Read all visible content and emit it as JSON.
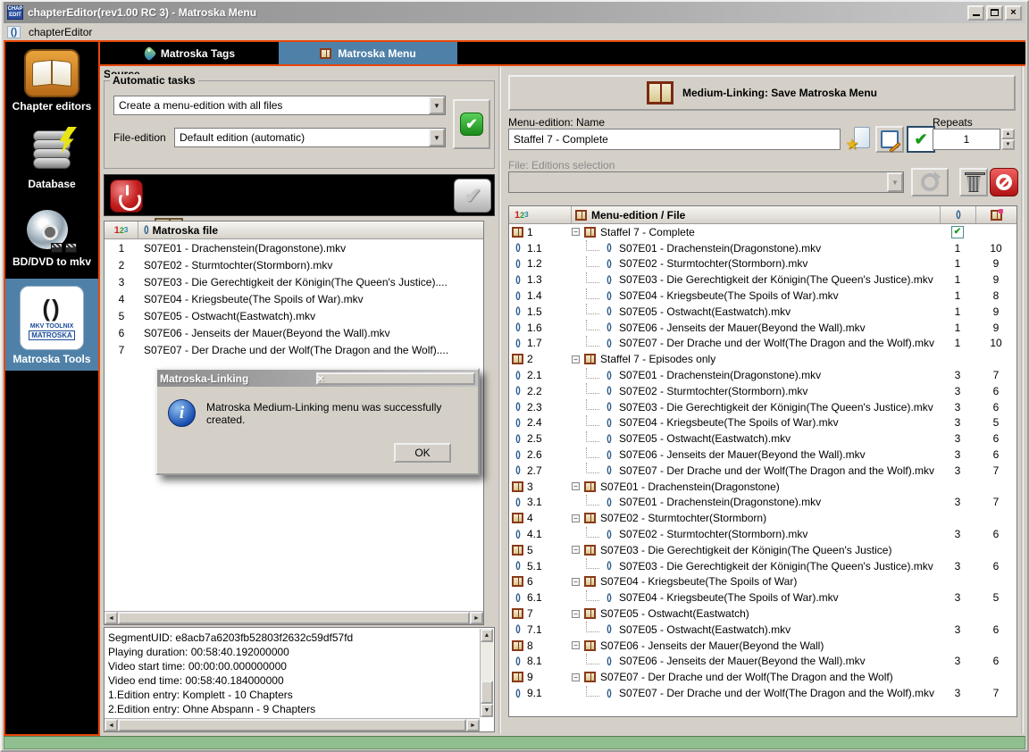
{
  "window": {
    "title": "chapterEditor(rev1.00 RC 3) - Matroska Menu",
    "app_icon_line1": "CHAP",
    "app_icon_line2": "EDIT"
  },
  "menu_bar": {
    "item": "chapterEditor"
  },
  "sidebar": {
    "items": [
      {
        "label": "Chapter editors"
      },
      {
        "label": "Database"
      },
      {
        "label": "BD/DVD to mkv"
      },
      {
        "label": "Matroska Tools",
        "icon_text_1": "MKV TOOLNIX",
        "icon_text_2": "MATROSKA"
      }
    ]
  },
  "tabs": [
    {
      "label": "Matroska Tags"
    },
    {
      "label": "Matroska Menu"
    }
  ],
  "num_header": {
    "d1": "1",
    "d2": "2",
    "d3": "3"
  },
  "source": {
    "title": "Source",
    "group_title": "Automatic tasks",
    "task_value": "Create a menu-edition with all files",
    "file_edition_label": "File-edition",
    "file_edition_value": "Default edition (automatic)"
  },
  "file_table": {
    "file_col": "Matroska file",
    "rows": [
      {
        "n": "1",
        "file": "S07E01 - Drachenstein(Dragonstone).mkv"
      },
      {
        "n": "2",
        "file": "S07E02 - Sturmtochter(Stormborn).mkv"
      },
      {
        "n": "3",
        "file": "S07E03 - Die Gerechtigkeit der Königin(The Queen's Justice)...."
      },
      {
        "n": "4",
        "file": "S07E04 - Kriegsbeute(The Spoils of War).mkv"
      },
      {
        "n": "5",
        "file": "S07E05 - Ostwacht(Eastwatch).mkv"
      },
      {
        "n": "6",
        "file": "S07E06 - Jenseits der Mauer(Beyond the Wall).mkv"
      },
      {
        "n": "7",
        "file": "S07E07 - Der Drache und der Wolf(The Dragon and the Wolf)...."
      }
    ]
  },
  "dialog": {
    "title": "Matroska-Linking",
    "message": "Matroska Medium-Linking menu was successfully created.",
    "ok": "OK"
  },
  "info_box": {
    "lines": [
      "SegmentUID: e8acb7a6203fb52803f2632c59df57fd",
      "Playing duration: 00:58:40.192000000",
      "Video start time: 00:00:00.000000000",
      "Video end time: 00:58:40.184000000",
      "1.Edition entry: Komplett - 10 Chapters",
      "2.Edition entry: Ohne Abspann - 9 Chapters"
    ]
  },
  "right_panel": {
    "banner": "Medium-Linking: Save Matroska Menu",
    "name_label": "Menu-edition: Name",
    "name_value": "Staffel 7 - Complete",
    "repeats_label": "Repeats",
    "repeats_value": "1",
    "editions_label": "File: Editions selection",
    "editions_value": ""
  },
  "tree": {
    "file_col": "Menu-edition / File",
    "rows": [
      {
        "id": "1",
        "type": "menu",
        "label": "Staffel 7 - Complete",
        "c1": "✔",
        "c2": ""
      },
      {
        "id": "1.1",
        "type": "file",
        "label": "S07E01 - Drachenstein(Dragonstone).mkv",
        "c1": "1",
        "c2": "10"
      },
      {
        "id": "1.2",
        "type": "file",
        "label": "S07E02 - Sturmtochter(Stormborn).mkv",
        "c1": "1",
        "c2": "9"
      },
      {
        "id": "1.3",
        "type": "file",
        "label": "S07E03 - Die Gerechtigkeit der Königin(The Queen's Justice).mkv",
        "c1": "1",
        "c2": "9"
      },
      {
        "id": "1.4",
        "type": "file",
        "label": "S07E04 - Kriegsbeute(The Spoils of War).mkv",
        "c1": "1",
        "c2": "8"
      },
      {
        "id": "1.5",
        "type": "file",
        "label": "S07E05 - Ostwacht(Eastwatch).mkv",
        "c1": "1",
        "c2": "9"
      },
      {
        "id": "1.6",
        "type": "file",
        "label": "S07E06 - Jenseits der Mauer(Beyond the Wall).mkv",
        "c1": "1",
        "c2": "9"
      },
      {
        "id": "1.7",
        "type": "file",
        "label": "S07E07 - Der Drache und der Wolf(The Dragon and the Wolf).mkv",
        "c1": "1",
        "c2": "10"
      },
      {
        "id": "2",
        "type": "menu",
        "label": "Staffel 7 - Episodes only",
        "c1": "",
        "c2": ""
      },
      {
        "id": "2.1",
        "type": "file",
        "label": "S07E01 - Drachenstein(Dragonstone).mkv",
        "c1": "3",
        "c2": "7"
      },
      {
        "id": "2.2",
        "type": "file",
        "label": "S07E02 - Sturmtochter(Stormborn).mkv",
        "c1": "3",
        "c2": "6"
      },
      {
        "id": "2.3",
        "type": "file",
        "label": "S07E03 - Die Gerechtigkeit der Königin(The Queen's Justice).mkv",
        "c1": "3",
        "c2": "6"
      },
      {
        "id": "2.4",
        "type": "file",
        "label": "S07E04 - Kriegsbeute(The Spoils of War).mkv",
        "c1": "3",
        "c2": "5"
      },
      {
        "id": "2.5",
        "type": "file",
        "label": "S07E05 - Ostwacht(Eastwatch).mkv",
        "c1": "3",
        "c2": "6"
      },
      {
        "id": "2.6",
        "type": "file",
        "label": "S07E06 - Jenseits der Mauer(Beyond the Wall).mkv",
        "c1": "3",
        "c2": "6"
      },
      {
        "id": "2.7",
        "type": "file",
        "label": "S07E07 - Der Drache und der Wolf(The Dragon and the Wolf).mkv",
        "c1": "3",
        "c2": "7"
      },
      {
        "id": "3",
        "type": "menu",
        "label": "S07E01 - Drachenstein(Dragonstone)",
        "c1": "",
        "c2": ""
      },
      {
        "id": "3.1",
        "type": "file",
        "label": "S07E01 - Drachenstein(Dragonstone).mkv",
        "c1": "3",
        "c2": "7"
      },
      {
        "id": "4",
        "type": "menu",
        "label": "S07E02 - Sturmtochter(Stormborn)",
        "c1": "",
        "c2": ""
      },
      {
        "id": "4.1",
        "type": "file",
        "label": "S07E02 - Sturmtochter(Stormborn).mkv",
        "c1": "3",
        "c2": "6"
      },
      {
        "id": "5",
        "type": "menu",
        "label": "S07E03 - Die Gerechtigkeit der Königin(The Queen's Justice)",
        "c1": "",
        "c2": ""
      },
      {
        "id": "5.1",
        "type": "file",
        "label": "S07E03 - Die Gerechtigkeit der Königin(The Queen's Justice).mkv",
        "c1": "3",
        "c2": "6"
      },
      {
        "id": "6",
        "type": "menu",
        "label": "S07E04 - Kriegsbeute(The Spoils of War)",
        "c1": "",
        "c2": ""
      },
      {
        "id": "6.1",
        "type": "file",
        "label": "S07E04 - Kriegsbeute(The Spoils of War).mkv",
        "c1": "3",
        "c2": "5"
      },
      {
        "id": "7",
        "type": "menu",
        "label": "S07E05 - Ostwacht(Eastwatch)",
        "c1": "",
        "c2": ""
      },
      {
        "id": "7.1",
        "type": "file",
        "label": "S07E05 - Ostwacht(Eastwatch).mkv",
        "c1": "3",
        "c2": "6"
      },
      {
        "id": "8",
        "type": "menu",
        "label": "S07E06 - Jenseits der Mauer(Beyond the Wall)",
        "c1": "",
        "c2": ""
      },
      {
        "id": "8.1",
        "type": "file",
        "label": "S07E06 - Jenseits der Mauer(Beyond the Wall).mkv",
        "c1": "3",
        "c2": "6"
      },
      {
        "id": "9",
        "type": "menu",
        "label": "S07E07 - Der Drache und der Wolf(The Dragon and the Wolf)",
        "c1": "",
        "c2": ""
      },
      {
        "id": "9.1",
        "type": "file",
        "label": "S07E07 - Der Drache und der Wolf(The Dragon and the Wolf).mkv",
        "c1": "3",
        "c2": "7"
      }
    ]
  },
  "icons": {
    "check": "✔",
    "dropdown_arrow": "▼",
    "up_arrow": "▲",
    "down_arrow": "▼",
    "left_arrow": "◄",
    "right_arrow": "►",
    "close": "×",
    "collapse_minus": "−",
    "star": "★",
    "info_i": "i",
    "matroska_glyph": "()"
  },
  "colors": {
    "accent_orange": "#e8470a",
    "tab_blue": "#4f81a8",
    "status_green": "#8fbe8f",
    "toolbar_black": "#000000",
    "check_green": "#1a9a1a",
    "power_red": "#c41e1e"
  }
}
